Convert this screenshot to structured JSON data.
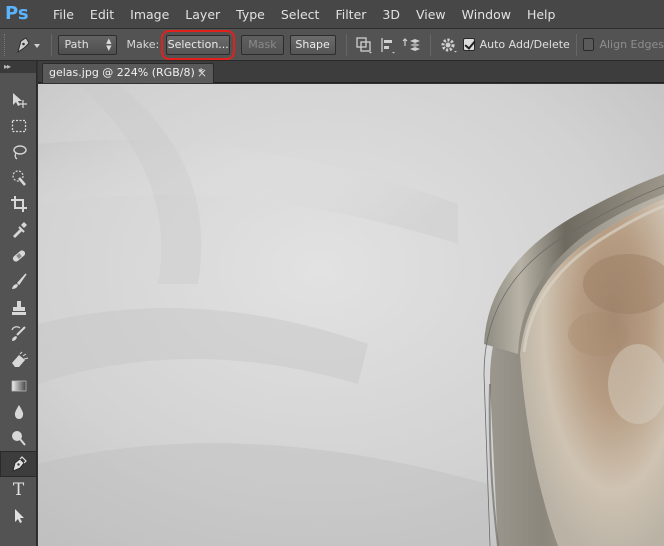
{
  "app": {
    "logo": "Ps",
    "menu": [
      "File",
      "Edit",
      "Image",
      "Layer",
      "Type",
      "Select",
      "Filter",
      "3D",
      "View",
      "Window",
      "Help"
    ]
  },
  "options": {
    "mode_select": "Path",
    "make_label": "Make:",
    "selection_button": "Selection...",
    "mask_button": "Mask",
    "shape_button": "Shape",
    "auto_add_delete": {
      "label": "Auto Add/Delete",
      "checked": true
    },
    "align_edges": {
      "label": "Align Edges",
      "checked": false
    }
  },
  "document": {
    "tab_title": "gelas.jpg @ 224% (RGB/8) *",
    "close_glyph": "×"
  },
  "toolbar": {
    "collapse_glyph": "▸▸",
    "tools": [
      "move-tool",
      "rectangular-marquee-tool",
      "lasso-tool",
      "quick-selection-tool",
      "crop-tool",
      "eyedropper-tool",
      "spot-healing-brush-tool",
      "brush-tool",
      "clone-stamp-tool",
      "history-brush-tool",
      "eraser-tool",
      "gradient-tool",
      "blur-tool",
      "dodge-tool",
      "pen-tool",
      "type-tool",
      "path-selection-tool"
    ],
    "active_tool": "pen-tool",
    "type_glyph": "T"
  },
  "colors": {
    "highlight_ring": "#e3211c",
    "ps_logo": "#5ab4ff"
  }
}
